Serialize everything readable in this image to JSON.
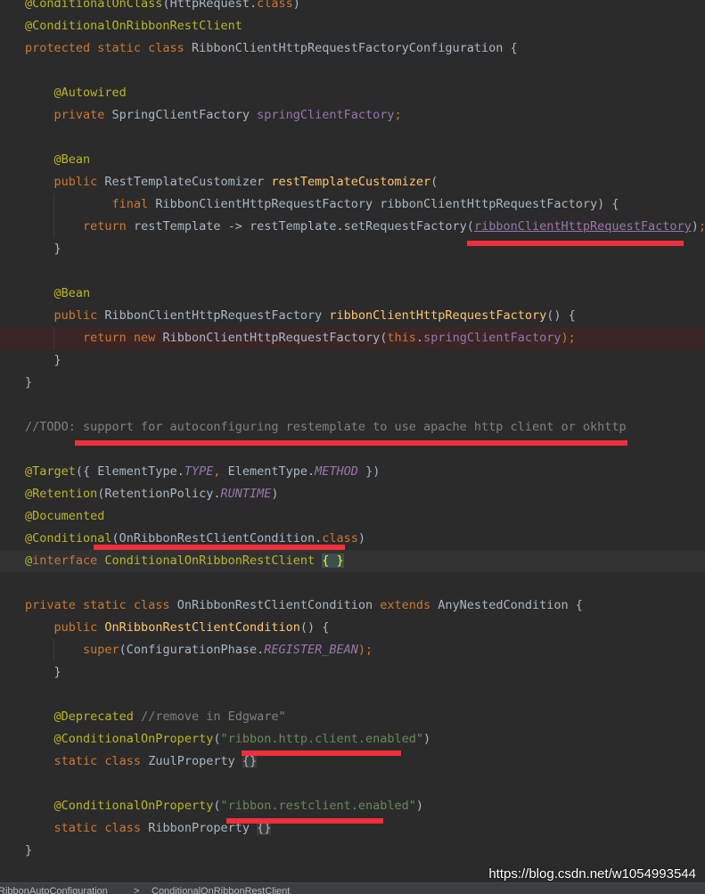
{
  "editor": {
    "lines": [
      [
        [
          "@ConditionalOnClass",
          "ann"
        ],
        [
          "(HttpRequest.",
          ""
        ],
        [
          "class",
          "kw"
        ],
        [
          ")",
          ""
        ]
      ],
      [
        [
          "@ConditionalOnRibbonRestClient",
          "ann"
        ]
      ],
      [
        [
          "protected static class ",
          "kw"
        ],
        [
          "RibbonClientHttpRequestFactoryConfiguration {",
          ""
        ]
      ],
      [],
      [
        [
          "    ",
          ""
        ],
        [
          "@Autowired",
          "ann"
        ]
      ],
      [
        [
          "    ",
          ""
        ],
        [
          "private ",
          "kw"
        ],
        [
          "SpringClientFactory ",
          ""
        ],
        [
          "springClientFactory",
          "fld"
        ],
        [
          ";",
          "kw"
        ]
      ],
      [],
      [
        [
          "    ",
          ""
        ],
        [
          "@Bean",
          "ann"
        ]
      ],
      [
        [
          "    ",
          ""
        ],
        [
          "public ",
          "kw"
        ],
        [
          "RestTemplateCustomizer ",
          ""
        ],
        [
          "restTemplateCustomizer",
          "fn"
        ],
        [
          "(",
          ""
        ]
      ],
      [
        [
          "            ",
          ""
        ],
        [
          "final ",
          "kw"
        ],
        [
          "RibbonClientHttpRequestFactory ribbonClientHttpRequestFactory) {",
          ""
        ]
      ],
      [
        [
          "        ",
          ""
        ],
        [
          "return ",
          "kw"
        ],
        [
          "restTemplate -> restTemplate.setRequestFactory(",
          ""
        ],
        [
          "ribbonClientHttpRequestFactory",
          "ul"
        ],
        [
          ")",
          ""
        ],
        [
          ";",
          "kw"
        ]
      ],
      [
        [
          "    }",
          ""
        ]
      ],
      [],
      [
        [
          "    ",
          ""
        ],
        [
          "@Bean",
          "ann"
        ]
      ],
      [
        [
          "    ",
          ""
        ],
        [
          "public ",
          "kw"
        ],
        [
          "RibbonClientHttpRequestFactory ",
          ""
        ],
        [
          "ribbonClientHttpRequestFactory",
          "fn"
        ],
        [
          "() {",
          ""
        ]
      ],
      [
        [
          "        ",
          ""
        ],
        [
          "return new ",
          "kw"
        ],
        [
          "RibbonClientHttpRequestFactory(",
          ""
        ],
        [
          "this",
          "kw"
        ],
        [
          ".",
          ""
        ],
        [
          "springClientFactory",
          "fld"
        ],
        [
          ");",
          "kw"
        ]
      ],
      [
        [
          "    }",
          ""
        ]
      ],
      [
        [
          "}",
          ""
        ]
      ],
      [],
      [
        [
          "//TODO: support for autoconfiguring restemplate to use apache http client or okhttp",
          "cmt"
        ]
      ],
      [],
      [
        [
          "@Target",
          "ann"
        ],
        [
          "({ ElementType.",
          ""
        ],
        [
          "TYPE",
          "it"
        ],
        [
          ", ",
          "kw"
        ],
        [
          "ElementType.",
          ""
        ],
        [
          "METHOD ",
          "it"
        ],
        [
          "})",
          ""
        ]
      ],
      [
        [
          "@Retention",
          "ann"
        ],
        [
          "(RetentionPolicy.",
          ""
        ],
        [
          "RUNTIME",
          "it"
        ],
        [
          ")",
          ""
        ]
      ],
      [
        [
          "@Documented",
          "ann"
        ]
      ],
      [
        [
          "@Conditional",
          "ann"
        ],
        [
          "(OnRibbonRestClientCondition.",
          ""
        ],
        [
          "class",
          "kw"
        ],
        [
          ")",
          ""
        ]
      ],
      [
        [
          "@",
          "ann"
        ],
        [
          "interface ",
          "kw"
        ],
        [
          "ConditionalOnRibbonRestClient ",
          "ann"
        ],
        [
          "{ }",
          "brace"
        ]
      ],
      [],
      [
        [
          "private static class ",
          "kw"
        ],
        [
          "OnRibbonRestClientCondition ",
          ""
        ],
        [
          "extends ",
          "kw"
        ],
        [
          "AnyNestedCondition {",
          ""
        ]
      ],
      [
        [
          "    ",
          ""
        ],
        [
          "public ",
          "kw"
        ],
        [
          "OnRibbonRestClientCondition",
          "fn"
        ],
        [
          "() {",
          ""
        ]
      ],
      [
        [
          "        ",
          ""
        ],
        [
          "super",
          "kw"
        ],
        [
          "(ConfigurationPhase.",
          ""
        ],
        [
          "REGISTER_BEAN",
          "it"
        ],
        [
          ");",
          "kw"
        ]
      ],
      [
        [
          "    }",
          ""
        ]
      ],
      [],
      [
        [
          "    ",
          ""
        ],
        [
          "@Deprecated ",
          "ann"
        ],
        [
          "//remove in Edgware\"",
          "cmt"
        ]
      ],
      [
        [
          "    ",
          ""
        ],
        [
          "@ConditionalOnProperty",
          "ann"
        ],
        [
          "(",
          ""
        ],
        [
          "\"ribbon.http.client.enabled\"",
          "str"
        ],
        [
          ")",
          ""
        ]
      ],
      [
        [
          "    ",
          ""
        ],
        [
          "static class ",
          "kw"
        ],
        [
          "ZuulProperty ",
          ""
        ],
        [
          "{}",
          "fold"
        ]
      ],
      [],
      [
        [
          "    ",
          ""
        ],
        [
          "@ConditionalOnProperty",
          "ann"
        ],
        [
          "(",
          ""
        ],
        [
          "\"ribbon.restclient.enabled\"",
          "str"
        ],
        [
          ")",
          ""
        ]
      ],
      [
        [
          "    ",
          ""
        ],
        [
          "static class ",
          "kw"
        ],
        [
          "RibbonProperty ",
          ""
        ],
        [
          "{}",
          "fold"
        ]
      ],
      [
        [
          "}",
          ""
        ]
      ]
    ]
  },
  "breadcrumb": {
    "items": [
      "RibbonAutoConfiguration",
      "ConditionalOnRibbonRestClient"
    ],
    "separator": ">"
  },
  "watermark": "https://blog.csdn.net/w1054993544",
  "colors": {
    "background": "#2b2b2b",
    "keyword": "#cc7832",
    "annotation": "#bbb529",
    "method": "#ffc66d",
    "field": "#9876aa",
    "string": "#6a8759",
    "comment": "#808080",
    "highlight_underline": "#f12f3a"
  }
}
